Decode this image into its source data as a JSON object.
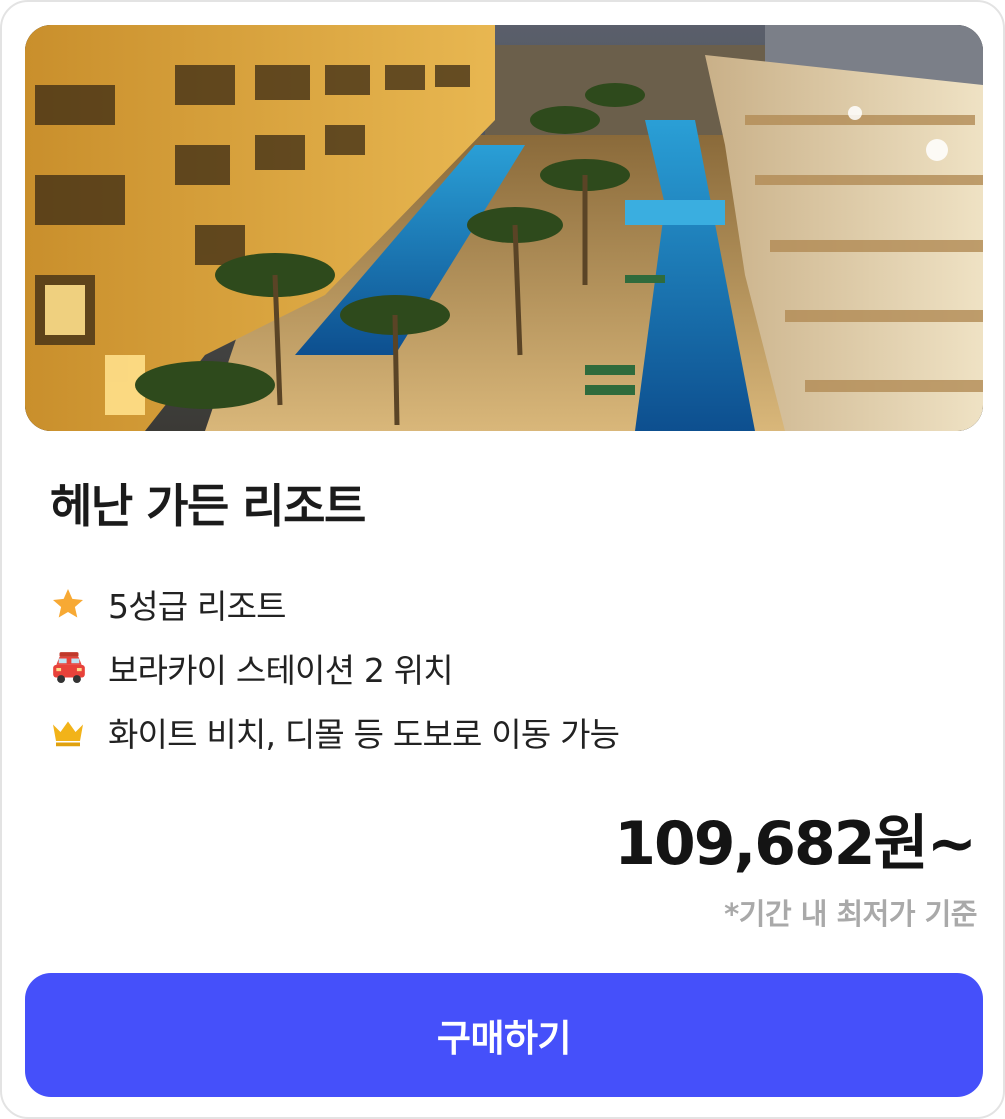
{
  "card": {
    "image_alt": "resort-photo",
    "title": "헤난 가든 리조트",
    "features": [
      {
        "icon": "star-icon",
        "text": "5성급 리조트"
      },
      {
        "icon": "car-icon",
        "text": "보라카이 스테이션 2 위치"
      },
      {
        "icon": "crown-icon",
        "text": "화이트 비치, 디몰 등 도보로 이동 가능"
      }
    ],
    "price": "109,682원~",
    "price_note": "*기간 내 최저가 기준",
    "buy_label": "구매하기"
  },
  "colors": {
    "accent": "#4550fa",
    "star": "#f7a934",
    "crown": "#f2b319",
    "car": "#e8423a",
    "note": "#a9a9a9"
  }
}
